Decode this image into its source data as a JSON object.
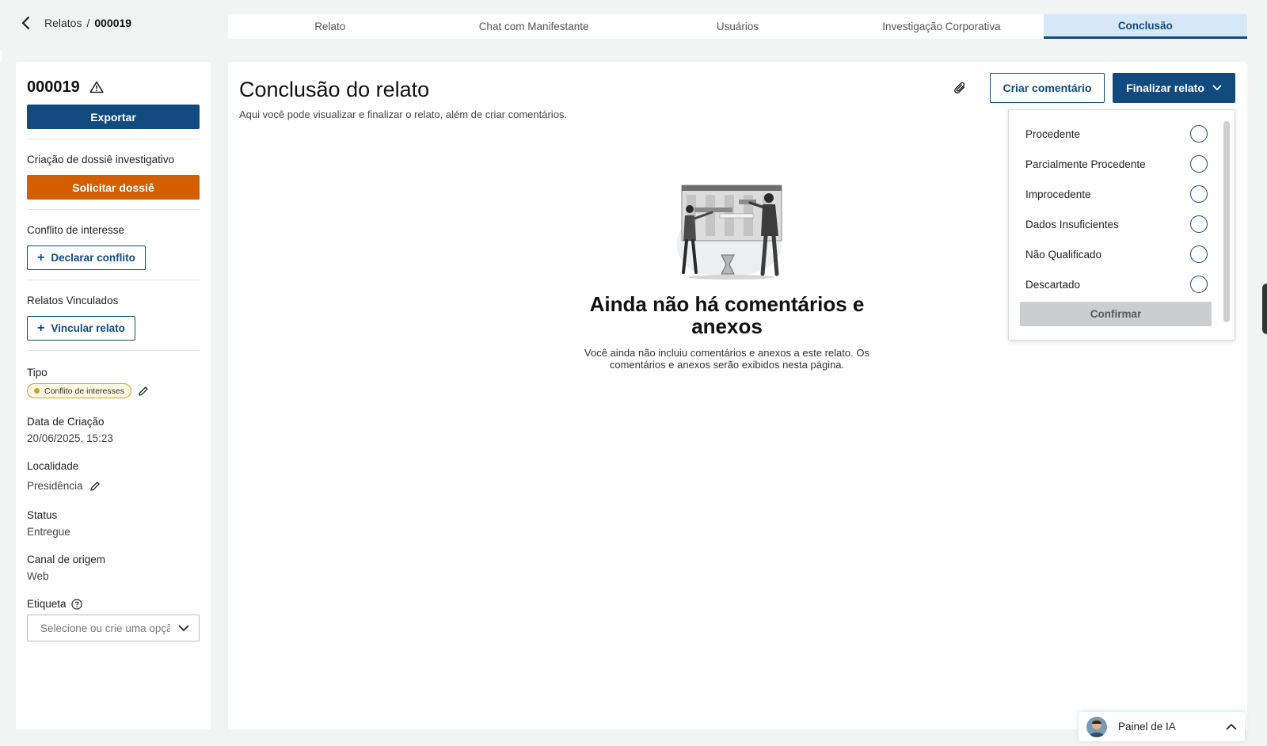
{
  "breadcrumb": {
    "parent": "Relatos",
    "separator": "/",
    "current": "000019"
  },
  "tabs": [
    {
      "label": "Relato",
      "active": false
    },
    {
      "label": "Chat com Manifestante",
      "active": false
    },
    {
      "label": "Usuários",
      "active": false
    },
    {
      "label": "Investigação Corporativa",
      "active": false
    },
    {
      "label": "Conclusão",
      "active": true
    }
  ],
  "sidebar": {
    "id": "000019",
    "export_label": "Exportar",
    "dossie_label": "Criação de dossiê investigativo",
    "dossie_button": "Solicitar dossiê",
    "conflict_label": "Conflito de interesse",
    "conflict_button": "Declarar conflito",
    "linked_label": "Relatos Vinculados",
    "linked_button": "Vincular relato",
    "plus": "+",
    "tipo_label": "Tipo",
    "tipo_value": "Conflito de interesses",
    "created_label": "Data de Criação",
    "created_value": "20/06/2025, 15:23",
    "locality_label": "Localidade",
    "locality_value": "Presidência",
    "status_label": "Status",
    "status_value": "Entregue",
    "channel_label": "Canal de origem",
    "channel_value": "Web",
    "tag_label": "Etiqueta",
    "tag_placeholder": "Selecione ou crie uma opção"
  },
  "main": {
    "title": "Conclusão do relato",
    "subtitle": "Aqui você pode visualizar e finalizar o relato, além de criar comentários.",
    "comment_button": "Criar comentário",
    "finalize_button": "Finalizar relato",
    "empty_title": "Ainda não há comentários e anexos",
    "empty_desc": "Você ainda não incluiu comentários e anexos a este relato. Os comentários e anexos serão exibidos nesta página."
  },
  "dropdown": {
    "options": [
      {
        "label": "Procedente"
      },
      {
        "label": "Parcialmente Procedente"
      },
      {
        "label": "Improcedente"
      },
      {
        "label": "Dados Insuficientes"
      },
      {
        "label": "Não Qualificado"
      },
      {
        "label": "Descartado"
      }
    ],
    "confirm_label": "Confirmar"
  },
  "ai_panel": {
    "label": "Painel de IA"
  },
  "colors": {
    "primary": "#114a7e",
    "orange": "#d35f00",
    "tab_active_bg": "#d6e8f7",
    "badge": "#c9a51a"
  },
  "icons": [
    "chevron-left-icon",
    "warning-icon",
    "plus-icon",
    "pencil-icon",
    "help-icon",
    "chevron-down-icon",
    "paperclip-icon",
    "chevron-up-icon"
  ]
}
